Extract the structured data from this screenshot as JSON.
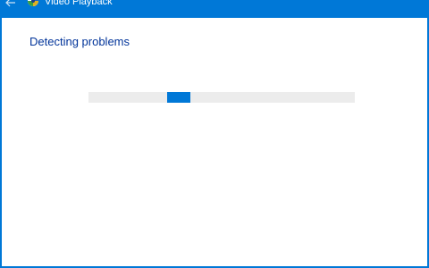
{
  "window": {
    "title": "Video Playback",
    "accent_color": "#0078d7"
  },
  "titlebar": {
    "back_icon": "back-arrow-icon",
    "app_icon": "troubleshooter-icon"
  },
  "main": {
    "heading": "Detecting problems",
    "progress": {
      "mode": "indeterminate",
      "fill_color": "#0078d7",
      "track_color": "#ececec"
    }
  }
}
